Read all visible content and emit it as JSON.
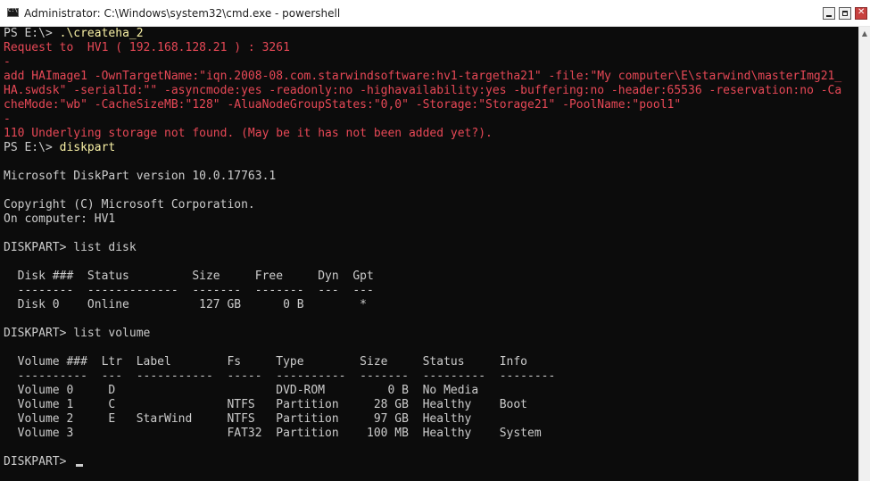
{
  "window": {
    "title": "Administrator: C:\\Windows\\system32\\cmd.exe - powershell"
  },
  "console": {
    "lines": [
      {
        "text": "PS E:\\> ",
        "cmd": ".\\createha_2",
        "style": "prompt"
      },
      {
        "text": "Request to  HV1 ( 192.168.128.21 ) : 3261",
        "style": "err"
      },
      {
        "text": "-",
        "style": "err"
      },
      {
        "text": "add HAImage1 -OwnTargetName:\"iqn.2008-08.com.starwindsoftware:hv1-targetha21\" -file:\"My computer\\E\\starwind\\masterImg21_",
        "style": "err"
      },
      {
        "text": "HA.swdsk\" -serialId:\"\" -asyncmode:yes -readonly:no -highavailability:yes -buffering:no -header:65536 -reservation:no -Ca",
        "style": "err"
      },
      {
        "text": "cheMode:\"wb\" -CacheSizeMB:\"128\" -AluaNodeGroupStates:\"0,0\" -Storage:\"Storage21\" -PoolName:\"pool1\"",
        "style": "err"
      },
      {
        "text": "-",
        "style": "err"
      },
      {
        "text": "110 Underlying storage not found. (May be it has not been added yet?).",
        "style": "err"
      },
      {
        "text": "PS E:\\> ",
        "cmd": "diskpart",
        "style": "prompt"
      },
      {
        "text": "",
        "style": "out"
      },
      {
        "text": "Microsoft DiskPart version 10.0.17763.1",
        "style": "out"
      },
      {
        "text": "",
        "style": "out"
      },
      {
        "text": "Copyright (C) Microsoft Corporation.",
        "style": "out"
      },
      {
        "text": "On computer: HV1",
        "style": "out"
      },
      {
        "text": "",
        "style": "out"
      },
      {
        "text": "DISKPART> list disk",
        "style": "out"
      },
      {
        "text": "",
        "style": "out"
      },
      {
        "text": "  Disk ###  Status         Size     Free     Dyn  Gpt",
        "style": "out"
      },
      {
        "text": "  --------  -------------  -------  -------  ---  ---",
        "style": "out"
      },
      {
        "text": "  Disk 0    Online          127 GB      0 B        *",
        "style": "out"
      },
      {
        "text": "",
        "style": "out"
      },
      {
        "text": "DISKPART> list volume",
        "style": "out"
      },
      {
        "text": "",
        "style": "out"
      },
      {
        "text": "  Volume ###  Ltr  Label        Fs     Type        Size     Status     Info",
        "style": "out"
      },
      {
        "text": "  ----------  ---  -----------  -----  ----------  -------  ---------  --------",
        "style": "out"
      },
      {
        "text": "  Volume 0     D                       DVD-ROM         0 B  No Media",
        "style": "out"
      },
      {
        "text": "  Volume 1     C                NTFS   Partition     28 GB  Healthy    Boot",
        "style": "out"
      },
      {
        "text": "  Volume 2     E   StarWind     NTFS   Partition     97 GB  Healthy",
        "style": "out"
      },
      {
        "text": "  Volume 3                      FAT32  Partition    100 MB  Healthy    System",
        "style": "out"
      },
      {
        "text": "",
        "style": "out"
      },
      {
        "text": "DISKPART> ",
        "style": "cursor"
      }
    ]
  }
}
